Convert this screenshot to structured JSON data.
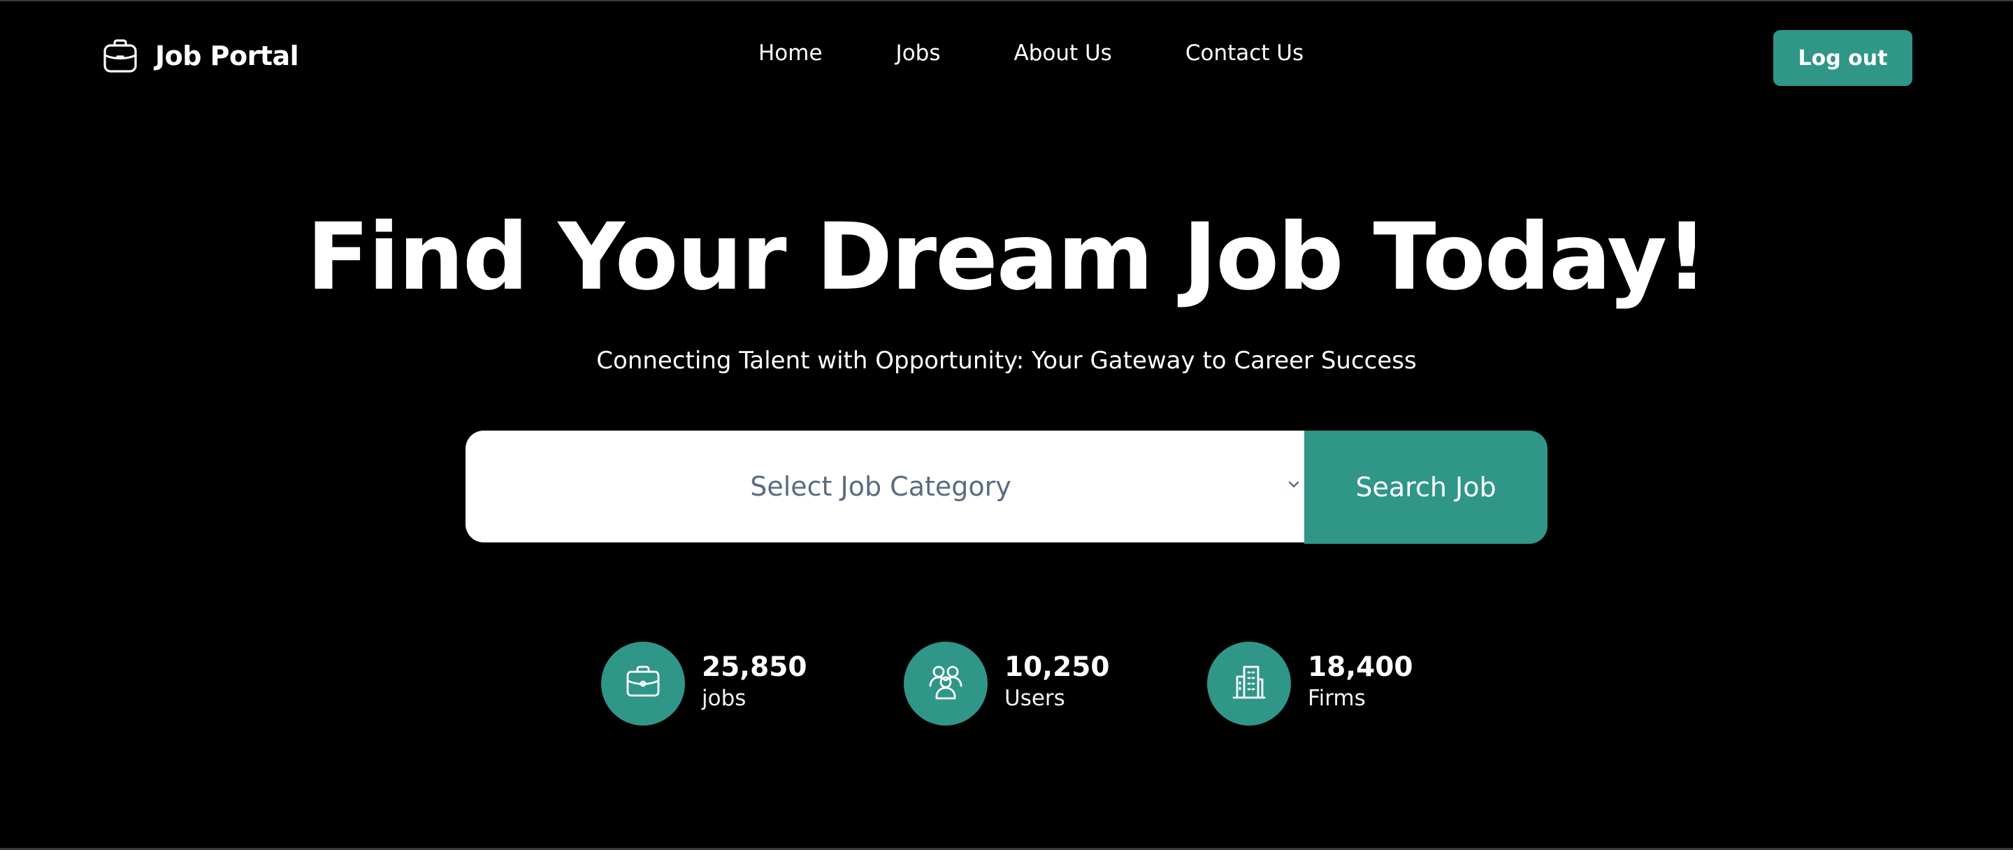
{
  "header": {
    "logo_text": "Job Portal",
    "logo_icon": "briefcase-icon",
    "nav": [
      {
        "label": "Home"
      },
      {
        "label": "Jobs"
      },
      {
        "label": "About Us"
      },
      {
        "label": "Contact Us"
      }
    ],
    "logout_label": "Log out"
  },
  "hero": {
    "title": "Find Your Dream Job Today!",
    "subtitle": "Connecting Talent with Opportunity: Your Gateway to Career Success"
  },
  "search": {
    "category_placeholder": "Select Job Category",
    "button_label": "Search Job"
  },
  "stats": [
    {
      "value": "25,850",
      "label": "jobs",
      "icon": "briefcase-icon"
    },
    {
      "value": "10,250",
      "label": "Users",
      "icon": "users-icon"
    },
    {
      "value": "18,400",
      "label": "Firms",
      "icon": "building-icon"
    }
  ],
  "colors": {
    "background": "#000000",
    "accent": "#2f9688",
    "text": "#ffffff",
    "placeholder": "#5b6b83"
  }
}
